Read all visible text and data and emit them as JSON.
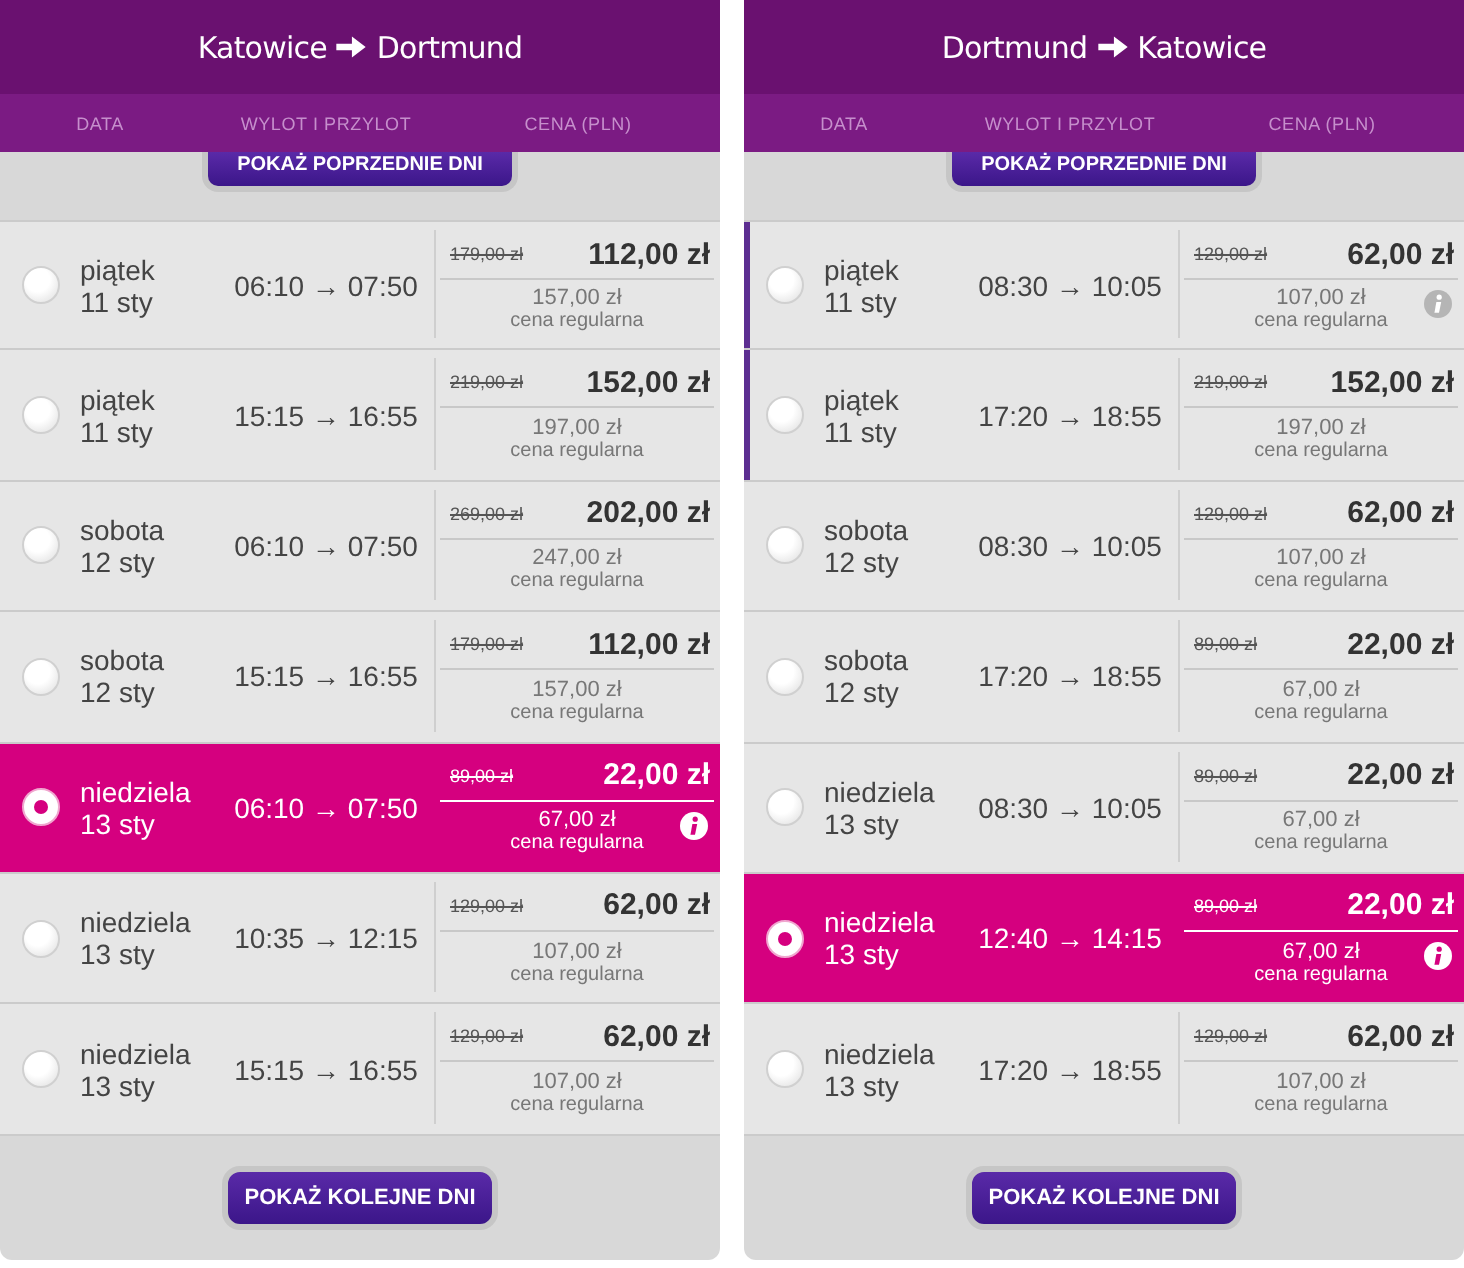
{
  "panels": [
    {
      "title": {
        "from": "Katowice",
        "to": "Dortmund"
      },
      "columns": [
        "DATA",
        "WYLOT I PRZYLOT",
        "CENA (PLN)"
      ],
      "prev_button": "POKAŻ POPRZEDNIE DNI",
      "flights": [
        {
          "day": "piątek",
          "date": "11 sty",
          "times": "06:10 → 07:50",
          "old_price": "179,00 zł",
          "price": "112,00 zł",
          "regular_price": "157,00 zł",
          "regular_label": "cena regularna",
          "info": false,
          "selected": false,
          "marked": false
        },
        {
          "day": "piątek",
          "date": "11 sty",
          "times": "15:15 → 16:55",
          "old_price": "219,00 zł",
          "price": "152,00 zł",
          "regular_price": "197,00 zł",
          "regular_label": "cena regularna",
          "info": false,
          "selected": false,
          "marked": false
        },
        {
          "day": "sobota",
          "date": "12 sty",
          "times": "06:10 → 07:50",
          "old_price": "269,00 zł",
          "price": "202,00 zł",
          "regular_price": "247,00 zł",
          "regular_label": "cena regularna",
          "info": false,
          "selected": false,
          "marked": false
        },
        {
          "day": "sobota",
          "date": "12 sty",
          "times": "15:15 → 16:55",
          "old_price": "179,00 zł",
          "price": "112,00 zł",
          "regular_price": "157,00 zł",
          "regular_label": "cena regularna",
          "info": false,
          "selected": false,
          "marked": false
        },
        {
          "day": "niedziela",
          "date": "13 sty",
          "times": "06:10 → 07:50",
          "old_price": "89,00 zł",
          "price": "22,00 zł",
          "regular_price": "67,00 zł",
          "regular_label": "cena regularna",
          "info": true,
          "selected": true,
          "marked": false
        },
        {
          "day": "niedziela",
          "date": "13 sty",
          "times": "10:35 → 12:15",
          "old_price": "129,00 zł",
          "price": "62,00 zł",
          "regular_price": "107,00 zł",
          "regular_label": "cena regularna",
          "info": false,
          "selected": false,
          "marked": false
        },
        {
          "day": "niedziela",
          "date": "13 sty",
          "times": "15:15 → 16:55",
          "old_price": "129,00 zł",
          "price": "62,00 zł",
          "regular_price": "107,00 zł",
          "regular_label": "cena regularna",
          "info": false,
          "selected": false,
          "marked": false
        }
      ],
      "next_button": "POKAŻ KOLEJNE DNI"
    },
    {
      "title": {
        "from": "Dortmund",
        "to": "Katowice"
      },
      "columns": [
        "DATA",
        "WYLOT I PRZYLOT",
        "CENA (PLN)"
      ],
      "prev_button": "POKAŻ POPRZEDNIE DNI",
      "flights": [
        {
          "day": "piątek",
          "date": "11 sty",
          "times": "08:30 → 10:05",
          "old_price": "129,00 zł",
          "price": "62,00 zł",
          "regular_price": "107,00 zł",
          "regular_label": "cena regularna",
          "info": true,
          "selected": false,
          "marked": true
        },
        {
          "day": "piątek",
          "date": "11 sty",
          "times": "17:20 → 18:55",
          "old_price": "219,00 zł",
          "price": "152,00 zł",
          "regular_price": "197,00 zł",
          "regular_label": "cena regularna",
          "info": false,
          "selected": false,
          "marked": true
        },
        {
          "day": "sobota",
          "date": "12 sty",
          "times": "08:30 → 10:05",
          "old_price": "129,00 zł",
          "price": "62,00 zł",
          "regular_price": "107,00 zł",
          "regular_label": "cena regularna",
          "info": false,
          "selected": false,
          "marked": false
        },
        {
          "day": "sobota",
          "date": "12 sty",
          "times": "17:20 → 18:55",
          "old_price": "89,00 zł",
          "price": "22,00 zł",
          "regular_price": "67,00 zł",
          "regular_label": "cena regularna",
          "info": false,
          "selected": false,
          "marked": false
        },
        {
          "day": "niedziela",
          "date": "13 sty",
          "times": "08:30 → 10:05",
          "old_price": "89,00 zł",
          "price": "22,00 zł",
          "regular_price": "67,00 zł",
          "regular_label": "cena regularna",
          "info": false,
          "selected": false,
          "marked": false
        },
        {
          "day": "niedziela",
          "date": "13 sty",
          "times": "12:40 → 14:15",
          "old_price": "89,00 zł",
          "price": "22,00 zł",
          "regular_price": "67,00 zł",
          "regular_label": "cena regularna",
          "info": true,
          "selected": true,
          "marked": false
        },
        {
          "day": "niedziela",
          "date": "13 sty",
          "times": "17:20 → 18:55",
          "old_price": "129,00 zł",
          "price": "62,00 zł",
          "regular_price": "107,00 zł",
          "regular_label": "cena regularna",
          "info": false,
          "selected": false,
          "marked": false
        }
      ],
      "next_button": "POKAŻ KOLEJNE DNI"
    }
  ]
}
